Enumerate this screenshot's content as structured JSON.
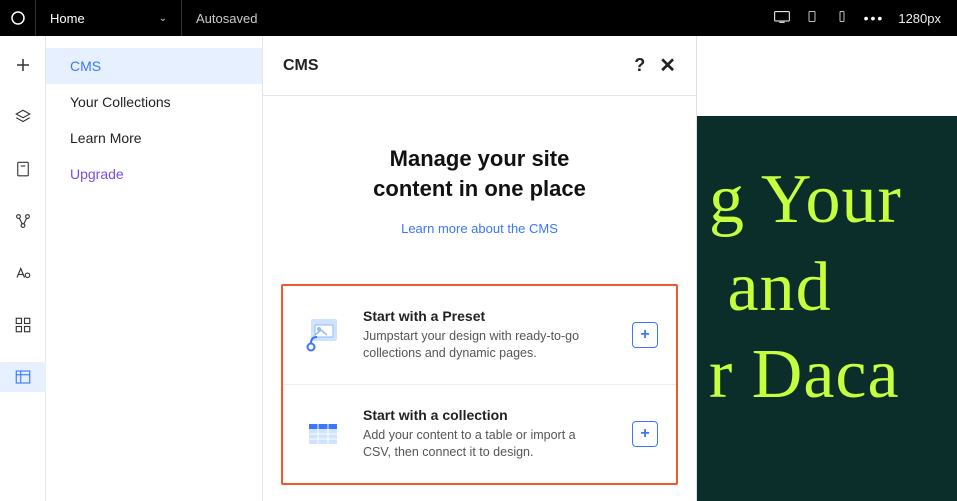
{
  "topbar": {
    "page_label": "Home",
    "autosave": "Autosaved",
    "breakpoint": "1280px"
  },
  "sidebar": {
    "items": [
      {
        "label": "CMS"
      },
      {
        "label": "Your Collections"
      },
      {
        "label": "Learn More"
      },
      {
        "label": "Upgrade"
      }
    ]
  },
  "panel": {
    "title": "CMS",
    "intro_line1": "Manage your site",
    "intro_line2": "content in one place",
    "learn_link": "Learn more about the CMS",
    "options": {
      "preset": {
        "title": "Start with a Preset",
        "desc": "Jumpstart your design with ready-to-go collections and dynamic pages."
      },
      "collection": {
        "title": "Start with a collection",
        "desc": "Add your content to a table or import a CSV, then connect it to design."
      }
    }
  },
  "canvas": {
    "hero_line1": "g Your",
    "hero_line2": " and",
    "hero_line3": "r Daca"
  }
}
